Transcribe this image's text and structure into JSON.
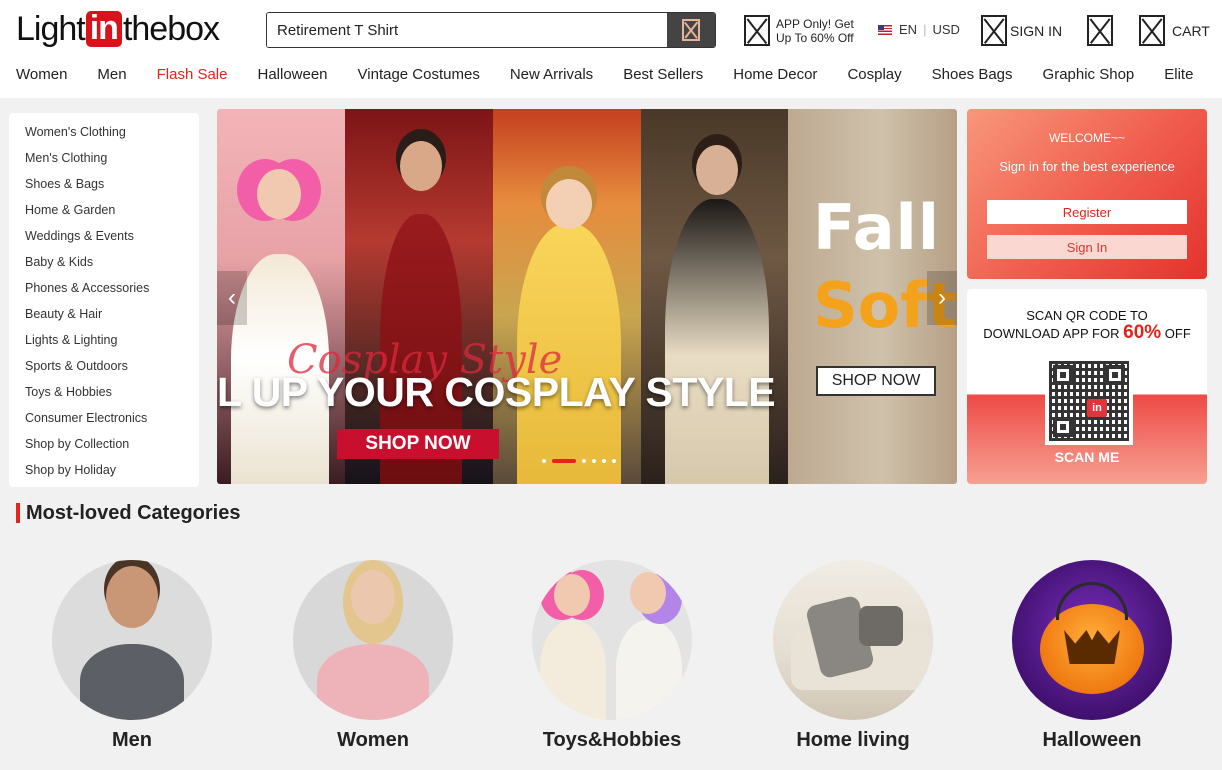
{
  "header": {
    "logo": {
      "left": "Light",
      "mid": "in",
      "right": "thebox"
    },
    "search": {
      "value": "Retirement T Shirt",
      "icon": "search-icon"
    },
    "app_promo": {
      "line1": "APP Only! Get",
      "line2": "Up To 60% Off"
    },
    "lang": {
      "code": "EN",
      "currency": "USD"
    },
    "signin_label": "SIGN IN",
    "cart_label": "CART"
  },
  "nav": [
    "Women",
    "Men",
    "Flash Sale",
    "Halloween",
    "Vintage Costumes",
    "New Arrivals",
    "Best Sellers",
    "Home Decor",
    "Cosplay",
    "Shoes Bags",
    "Graphic Shop",
    "Elite"
  ],
  "sidebar": {
    "items": [
      "Women's Clothing",
      "Men's Clothing",
      "Shoes & Bags",
      "Home & Garden",
      "Weddings & Events",
      "Baby & Kids",
      "Phones & Accessories",
      "Beauty & Hair",
      "Lights & Lighting",
      "Sports & Outdoors",
      "Toys & Hobbies",
      "Consumer Electronics",
      "Shop by Collection",
      "Shop by Holiday"
    ]
  },
  "banner": {
    "script_text": "Cosplay Style",
    "headline": "L UP YOUR COSPLAY STYLE",
    "cta_primary": "SHOP NOW",
    "slide2_line1": "Fall int",
    "slide2_line2": "Soft C",
    "cta_secondary": "SHOP NOW",
    "slides_count": 6,
    "active_slide": 2,
    "colors": {
      "accent": "#c8102e",
      "orange": "#f4a21b"
    }
  },
  "welcome": {
    "title": "WELCOME~~",
    "subtitle": "Sign in for the best experience",
    "register_label": "Register",
    "signin_label": "Sign In"
  },
  "qr_promo": {
    "line1": "SCAN QR CODE TO",
    "line2_prefix": "DOWNLOAD APP FOR ",
    "percent": "60%",
    "line2_suffix": " OFF",
    "scan_label": "SCAN ME"
  },
  "categories": {
    "title": "Most-loved Categories",
    "items": [
      "Men",
      "Women",
      "Toys&Hobbies",
      "Home living",
      "Halloween"
    ]
  },
  "colors": {
    "brand_red": "#e3241b",
    "logo_red": "#d9131c"
  }
}
